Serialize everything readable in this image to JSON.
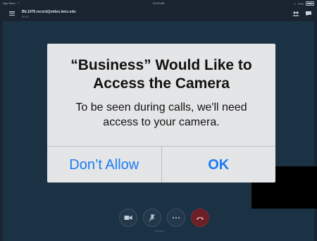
{
  "status_bar": {
    "carrier": "App Store",
    "time": "10:03 AM",
    "battery": "97%"
  },
  "call": {
    "title": "Bb.1076.record@video.lwcc.edu",
    "subtitle": "00:21",
    "control_label": "Camera"
  },
  "dialog": {
    "title_line1": "“Business” Would Like to",
    "title_line2": "Access the Camera",
    "message_line1": "To be seen during calls, we'll need",
    "message_line2": "access to your camera.",
    "deny_label": "Don’t Allow",
    "ok_label": "OK"
  },
  "icons": {
    "menu": "hamburger-icon",
    "participants": "participants-icon",
    "chat": "chat-icon",
    "camera": "camera-icon",
    "mute": "mic-off-icon",
    "more": "more-icon",
    "hangup": "phone-hangup-icon"
  },
  "colors": {
    "accent": "#1a7cf3",
    "background": "#1b3244",
    "hangup": "#c0392b"
  }
}
